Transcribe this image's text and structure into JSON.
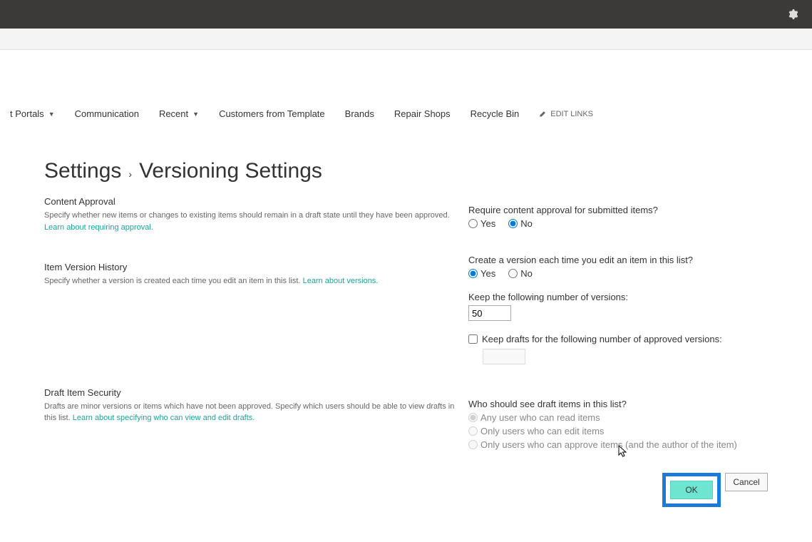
{
  "nav": {
    "items": [
      {
        "label": "t Portals",
        "hasDropdown": true
      },
      {
        "label": "Communication",
        "hasDropdown": false
      },
      {
        "label": "Recent",
        "hasDropdown": true
      },
      {
        "label": "Customers from Template",
        "hasDropdown": false
      },
      {
        "label": "Brands",
        "hasDropdown": false
      },
      {
        "label": "Repair Shops",
        "hasDropdown": false
      },
      {
        "label": "Recycle Bin",
        "hasDropdown": false
      }
    ],
    "editLinks": "EDIT LINKS"
  },
  "breadcrumb": {
    "settings": "Settings",
    "sep": "›",
    "current": "Versioning Settings"
  },
  "sections": {
    "contentApproval": {
      "title": "Content Approval",
      "desc": "Specify whether new items or changes to existing items should remain in a draft state until they have been approved.",
      "learn": "Learn about requiring approval."
    },
    "versionHistory": {
      "title": "Item Version History",
      "desc": "Specify whether a version is created each time you edit an item in this list.",
      "learn": "Learn about versions."
    },
    "draftSecurity": {
      "title": "Draft Item Security",
      "desc": "Drafts are minor versions or items which have not been approved. Specify which users should be able to view drafts in this list.",
      "learn": "Learn about specifying who can view and edit drafts."
    }
  },
  "form": {
    "approval": {
      "question": "Require content approval for submitted items?",
      "yes": "Yes",
      "no": "No",
      "value": "no"
    },
    "createVersion": {
      "question": "Create a version each time you edit an item in this list?",
      "yes": "Yes",
      "no": "No",
      "value": "yes"
    },
    "keepVersions": {
      "label": "Keep the following number of versions:",
      "value": "50"
    },
    "keepDrafts": {
      "label": "Keep drafts for the following number of approved versions:",
      "checked": false,
      "value": ""
    },
    "draftVisibility": {
      "question": "Who should see draft items in this list?",
      "options": [
        "Any user who can read items",
        "Only users who can edit items",
        "Only users who can approve items (and the author of the item)"
      ],
      "selected": 0
    },
    "buttons": {
      "ok": "OK",
      "cancel": "Cancel"
    }
  }
}
